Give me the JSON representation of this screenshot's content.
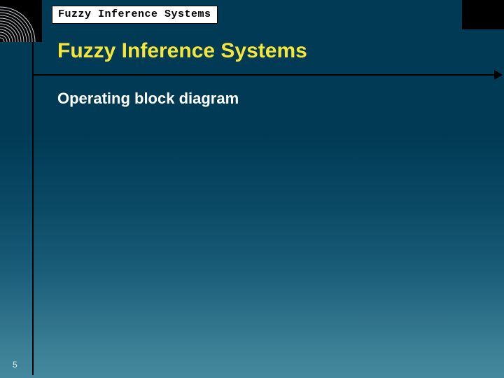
{
  "header": {
    "tab_label": "Fuzzy Inference Systems"
  },
  "title": "Fuzzy Inference Systems",
  "subtitle": "Operating block diagram",
  "page_number": "5",
  "colors": {
    "title": "#f7e63a",
    "subtitle": "#ffffff",
    "bg_top": "#003a55",
    "bg_bottom": "#45899e",
    "accent_black": "#000000"
  }
}
